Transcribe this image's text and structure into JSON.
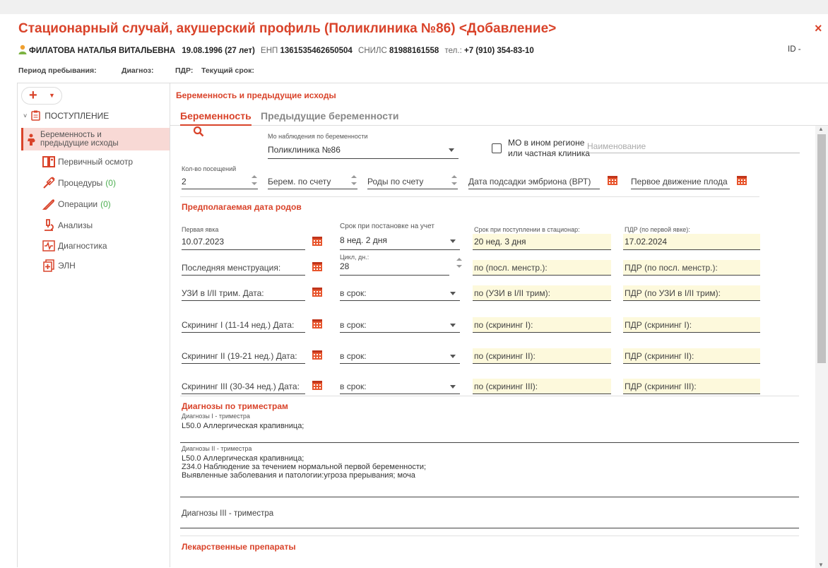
{
  "window": {
    "title": "Стационарный случай, акушерский профиль (Поликлиника №86) <Добавление>",
    "close": "×"
  },
  "patient": {
    "name": "ФИЛАТОВА НАТАЛЬЯ ВИТАЛЬЕВНА",
    "dob": "19.08.1996 (27 лет)",
    "enp_label": "ЕНП",
    "enp": "1361535462650504",
    "snils_label": "СНИЛС",
    "snils": "81988161558",
    "phone_label": "тел.:",
    "phone": "+7 (910) 354-83-10",
    "id": "ID -"
  },
  "period": {
    "stay": "Период пребывания:",
    "diag": "Диагноз:",
    "pdr": "ПДР:",
    "term": "Текущий срок:"
  },
  "sidebar": {
    "add": "+",
    "group": "ПОСТУПЛЕНИЕ",
    "items": [
      {
        "label1": "Беременность и",
        "label2": "предыдущие исходы"
      },
      {
        "label": "Первичный осмотр"
      },
      {
        "label": "Процедуры",
        "count": "(0)"
      },
      {
        "label": "Операции",
        "count": "(0)"
      },
      {
        "label": "Анализы"
      },
      {
        "label": "Диагностика"
      },
      {
        "label": "ЭЛН"
      }
    ]
  },
  "section_title": "Беременность и предыдущие исходы",
  "tabs": [
    "Беременность",
    "Предыдущие беременности"
  ],
  "form": {
    "mo_caption": "Мо наблюдения по беременности",
    "mo_value": "Поликлиника №86",
    "other_region_1": "МО в ином регионе",
    "other_region_2": "или частная клиника",
    "name_placeholder": "Наименование",
    "visits_caption": "Кол-во посещений",
    "visits_value": "2",
    "preg_count": "Берем. по счету",
    "births_count": "Роды по счету",
    "embryo_date": "Дата подсадки эмбриона (ВРТ)",
    "first_movement": "Первое движение плода",
    "due_title": "Предполагаемая дата родов",
    "first_visit_caption": "Первая явка",
    "first_visit_value": "10.07.2023",
    "term_reg_caption": "Срок при постановке на учет",
    "term_reg_value": "8 нед. 2 дня",
    "term_adm_caption": "Срок при поступлении в стационар:",
    "term_adm_value": "20 нед. 3 дня",
    "pdr_first_caption": "ПДР (по первой явке):",
    "pdr_first_value": "17.02.2024",
    "last_mens": "Последняя менструация:",
    "cycle_caption": "Цикл, дн.:",
    "cycle_value": "28",
    "by_mens": "по (посл. менстр.):",
    "pdr_mens": "ПДР (по посл. менстр.):",
    "rows": [
      {
        "label": "УЗИ в I/II трим. Дата:",
        "term": "в срок:",
        "by": "по (УЗИ в I/II трим):",
        "pdr": "ПДР (по УЗИ в I/II трим):"
      },
      {
        "label": "Скрининг I (11-14 нед.) Дата:",
        "term": "в срок:",
        "by": "по (скрининг I):",
        "pdr": "ПДР (скрининг I):"
      },
      {
        "label": "Скрининг II (19-21 нед.) Дата:",
        "term": "в срок:",
        "by": "по (скрининг II):",
        "pdr": "ПДР (скрининг II):"
      },
      {
        "label": "Скрининг III (30-34 нед.) Дата:",
        "term": "в срок:",
        "by": "по (скрининг III):",
        "pdr": "ПДР (скрининг III):"
      }
    ],
    "diag_title": "Диагнозы по триместрам",
    "diag1_caption": "Диагнозы I - триместра",
    "diag1_value": "L50.0 Аллергическая крапивница;",
    "diag2_caption": "Диагнозы II - триместра",
    "diag2_lines": [
      "L50.0 Аллергическая крапивница;",
      "Z34.0 Наблюдение за течением нормальной первой беременности;",
      "Выявленные заболевания и патологии:угроза прерывания; моча"
    ],
    "diag3_label": "Диагнозы III - триместра",
    "drugs_title": "Лекарственные препараты"
  },
  "colors": {
    "accent": "#d9432a",
    "highlight": "#fdf9dc",
    "green": "#4caf50"
  }
}
